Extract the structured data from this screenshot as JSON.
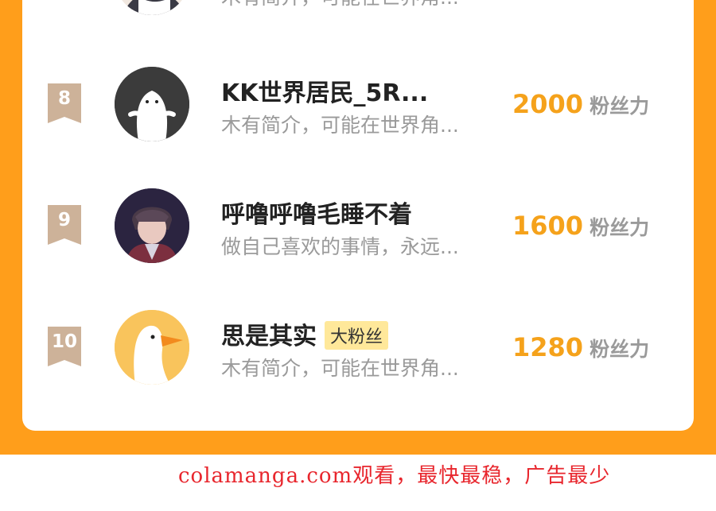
{
  "colors": {
    "page_background": "#FF9E1B",
    "card": "#FFFFFF",
    "rank_ribbon": "#CDB299",
    "score": "#F5A21B",
    "muted_text": "#9A9A9A",
    "badge_bg": "#FFE89A",
    "watermark": "#E8262D"
  },
  "partial_row": {
    "description": "木有简介，可能在世界角..."
  },
  "fan_list": [
    {
      "rank": "8",
      "name": "KK世界居民_5R...",
      "badge": "",
      "description": "木有简介，可能在世界角...",
      "score": "2000",
      "unit": "粉丝力",
      "avatar_icon": "ghost-avatar-icon"
    },
    {
      "rank": "9",
      "name": "呼噜呼噜毛睡不着",
      "badge": "",
      "description": "做自己喜欢的事情，永远...",
      "score": "1600",
      "unit": "粉丝力",
      "avatar_icon": "anime-boy-avatar"
    },
    {
      "rank": "10",
      "name": "思是其实",
      "badge": "大粉丝",
      "description": "木有简介，可能在世界角...",
      "score": "1280",
      "unit": "粉丝力",
      "avatar_icon": "goose-avatar-icon"
    }
  ],
  "watermark": "colamanga.com观看，最快最稳，广告最少"
}
